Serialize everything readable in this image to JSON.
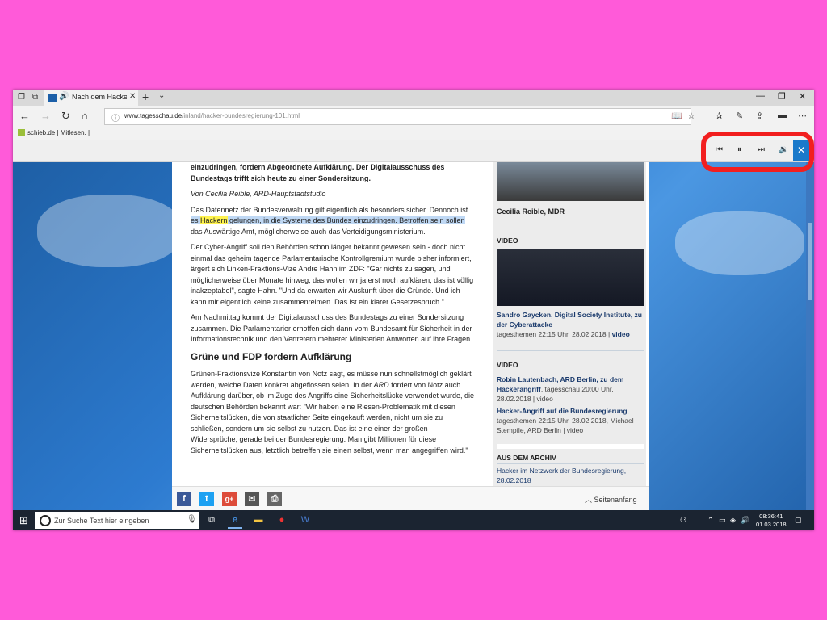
{
  "browser": {
    "tab_title": "Nach dem Hackera",
    "url_domain": "www.tagesschau.de",
    "url_path": "/inland/hacker-bundesregierung-101.html",
    "favorite": "schieb.de | Mitlesen. |"
  },
  "read_aloud": {
    "buttons": [
      "previous",
      "pause",
      "next",
      "voice-settings",
      "close"
    ]
  },
  "article": {
    "lead": "einzudringen, fordern Abgeordnete Aufklärung. Der Digitalausschuss des Bundestags trifft sich heute zu einer Sondersitzung.",
    "author": "Von Cecilia Reible, ARD-Hauptstadtstudio",
    "p1_a": "Das Datennetz der Bundesverwaltung gilt eigentlich als besonders sicher. Dennoch ist ",
    "p1_es": "es ",
    "p1_hackern": "Hackern",
    "p1_sel": " gelungen, in die Systeme des Bundes einzudringen. Betroffen sein sollen",
    "p1_b": " das Auswärtige Amt, möglicherweise auch das Verteidigungsministerium.",
    "p2": "Der Cyber-Angriff soll den Behörden schon länger bekannt gewesen sein - doch nicht einmal das geheim tagende Parlamentarische Kontrollgremium wurde bisher informiert, ärgert sich Linken-Fraktions-Vize Andre Hahn im ZDF: \"Gar nichts zu sagen, und möglicherweise über Monate hinweg, das wollen wir ja erst noch aufklären, das ist völlig inakzeptabel\", sagte Hahn. \"Und da erwarten wir Auskunft über die Gründe. Und ich kann mir eigentlich keine zusammenreimen. Das ist ein klarer Gesetzesbruch.\"",
    "p3": "Am Nachmittag kommt der Digitalausschuss des Bundestags zu einer Sondersitzung zusammen. Die Parlamentarier erhoffen sich dann vom Bundesamt für Sicherheit in der Informationstechnik und den Vertretern mehrerer Ministerien Antworten auf ihre Fragen.",
    "heading": "Grüne und FDP fordern Aufklärung",
    "p4_a": "Grünen-Fraktionsvize Konstantin von Notz sagt, es müsse nun schnellstmöglich geklärt werden, welche Daten konkret abgeflossen seien. In der ",
    "p4_ard": "ARD",
    "p4_b": " fordert von Notz auch Aufklärung darüber, ob im Zuge des Angriffs eine Sicherheitslücke verwendet wurde, die deutschen Behörden bekannt war: \"Wir haben eine Riesen-Problematik mit diesen Sicherheitslücken, die von staatlicher Seite eingekauft werden, nicht um sie zu schließen, sondern um sie selbst zu nutzen. Das ist eine einer der großen Widersprüche, gerade bei der Bundesregierung. Man gibt Millionen für diese Sicherheitslücken aus, letztlich betreffen sie einen selbst, wenn man angegriffen wird.\""
  },
  "sidebar": {
    "img1_caption": "Cecilia Reible, MDR",
    "video_label": "VIDEO",
    "video1_title": "Sandro Gaycken, Digital Society Institute, zu der Cyberattacke",
    "video1_meta": "tagesthemen 22:15 Uhr, 28.02.2018 | ",
    "video1_type": "video",
    "video_label2": "VIDEO",
    "v2_title": "Robin Lautenbach, ARD Berlin, zu dem Hackerangriff",
    "v2_meta": ", tagesschau 20:00 Uhr, 28.02.2018 | video",
    "v3_title": "Hacker-Angriff auf die Bundesregierung",
    "v3_meta": ", tagesthemen 22:15 Uhr, 28.02.2018, Michael Stempfle, ARD Berlin | video",
    "archive_label": "AUS DEM ARCHIV",
    "archive1": "Hacker im Netzwerk der Bundesregierung, 28.02.2018"
  },
  "share": {
    "top_link": "Seitenanfang"
  },
  "taskbar": {
    "search_placeholder": "Zur Suche Text hier eingeben",
    "time": "08:36:41",
    "date": "01.03.2018"
  },
  "colors": {
    "background": "#ff5ad9",
    "highlight_ring": "#f21f1f",
    "read_aloud_close": "#1979ca",
    "taskbar": "#1b2431"
  }
}
